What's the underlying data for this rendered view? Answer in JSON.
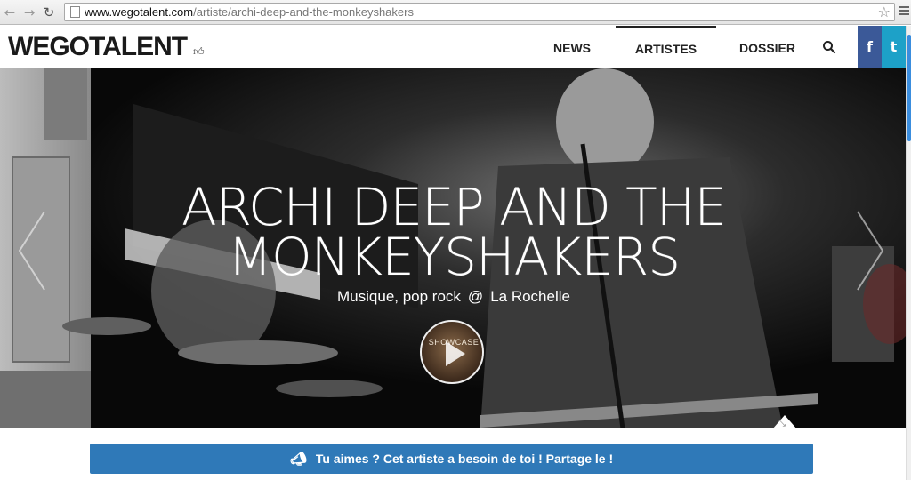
{
  "browser": {
    "url_host": "www.wegotalent.com",
    "url_path": "/artiste/archi-deep-and-the-monkeyshakers",
    "icons": {
      "back": "back-arrow-icon",
      "forward": "forward-arrow-icon",
      "reload": "reload-icon",
      "bookmark": "star-icon",
      "menu": "menu-icon"
    }
  },
  "header": {
    "logo": "WEGOTALENT",
    "nav": [
      {
        "label": "NEWS"
      },
      {
        "label": "ARTISTES",
        "active": true
      },
      {
        "label": "DOSSIER"
      }
    ],
    "social": {
      "facebook": "f",
      "twitter": "t"
    }
  },
  "hero": {
    "title": "ARCHI DEEP AND THE MONKEYSHAKERS",
    "genre": "Musique, pop rock",
    "at": "@",
    "city": "La Rochelle",
    "video_label": "SHOWCASE"
  },
  "share": {
    "label": "Tu aimes ? Cet artiste a besoin de toi ! Partage le !"
  },
  "colors": {
    "facebook": "#3b5998",
    "twitter": "#1da1c8",
    "share_bar": "#2f79b8"
  }
}
